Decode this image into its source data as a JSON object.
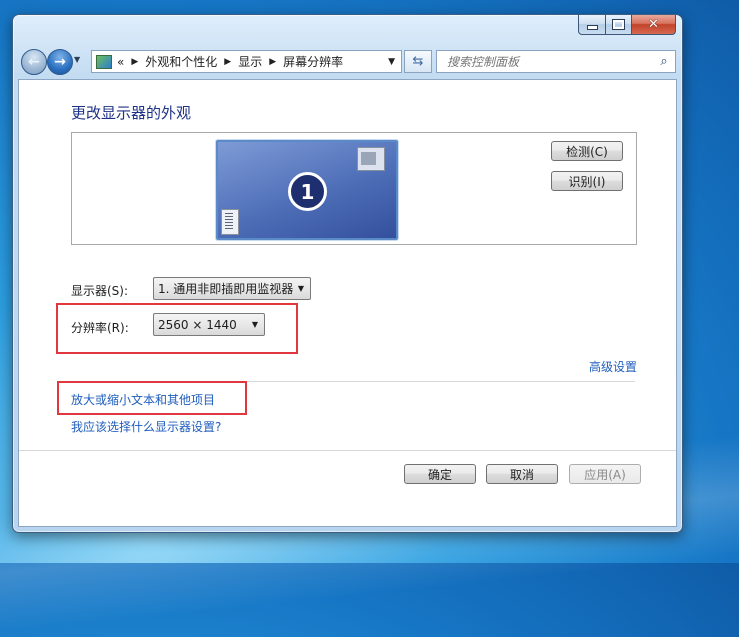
{
  "window": {
    "caption": {
      "minimize_icon": "minimize-icon",
      "maximize_icon": "maximize-icon",
      "close_icon": "close-icon"
    }
  },
  "nav": {
    "back_icon": "back-arrow-icon",
    "forward_icon": "forward-arrow-icon",
    "breadcrumb": {
      "overflow": "«",
      "items": [
        "外观和个性化",
        "显示",
        "屏幕分辨率"
      ]
    },
    "refresh_icon": "refresh-icon",
    "search_placeholder": "搜索控制面板",
    "search_icon": "magnifier-icon"
  },
  "page": {
    "title": "更改显示器的外观",
    "monitor_number": "1",
    "detect_label": "检测(C)",
    "identify_label": "识别(I)",
    "display_label": "显示器(S):",
    "display_value": "1. 通用非即插即用监视器",
    "resolution_label": "分辨率(R):",
    "resolution_value": "2560 × 1440",
    "advanced_link": "高级设置",
    "text_size_link": "放大或缩小文本和其他项目",
    "help_link": "我应该选择什么显示器设置?",
    "ok_label": "确定",
    "cancel_label": "取消",
    "apply_label": "应用(A)"
  },
  "colors": {
    "highlight_box": "#e2373f",
    "link": "#1f5ebd",
    "heading": "#1e3287"
  }
}
